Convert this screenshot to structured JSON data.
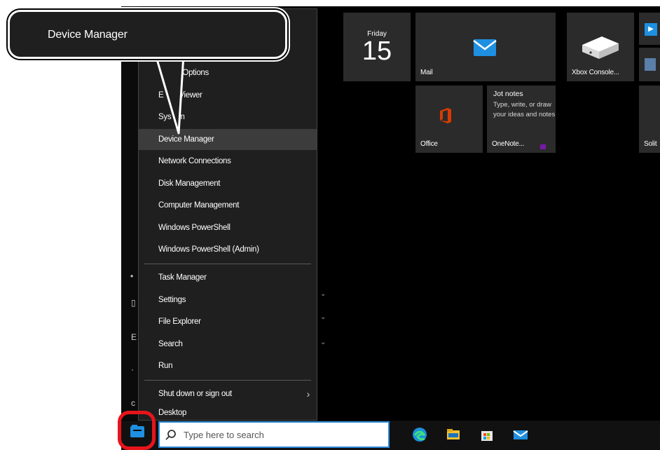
{
  "callout": {
    "text": "Device Manager"
  },
  "winx_menu": {
    "items": [
      {
        "label": "Power Options"
      },
      {
        "label": "Event Viewer"
      },
      {
        "label": "System"
      },
      {
        "label": "Device Manager",
        "selected": true
      },
      {
        "label": "Network Connections"
      },
      {
        "label": "Disk Management"
      },
      {
        "label": "Computer Management"
      },
      {
        "label": "Windows PowerShell"
      },
      {
        "label": "Windows PowerShell (Admin)"
      },
      {
        "label": "Task Manager"
      },
      {
        "label": "Settings"
      },
      {
        "label": "File Explorer"
      },
      {
        "label": "Search"
      },
      {
        "label": "Run"
      },
      {
        "label": "Shut down or sign out",
        "has_submenu": true
      },
      {
        "label": "Desktop"
      }
    ],
    "visible_partial_labels": {
      "power_options": "r Options",
      "event_viewer_prefix": "E",
      "event_viewer_suffix": "Viewer",
      "system_prefix": "Sys",
      "system_suffix": "m"
    }
  },
  "tiles": {
    "calendar": {
      "day": "Friday",
      "date": "15"
    },
    "mail": {
      "label": "Mail",
      "icon": "mail-icon"
    },
    "xbox": {
      "label": "Xbox Console...",
      "icon": "xbox-console-icon"
    },
    "office": {
      "label": "Office",
      "icon": "office-icon"
    },
    "onenote": {
      "title": "Jot notes",
      "body": "Type, write, or draw your ideas and notes",
      "label": "OneNote...",
      "icon": "onenote-icon"
    },
    "solitaire": {
      "label": "Solit"
    }
  },
  "taskbar": {
    "search_placeholder": "Type here to search",
    "icons": [
      "edge-icon",
      "file-explorer-icon",
      "store-icon",
      "mail-icon"
    ]
  },
  "colors": {
    "highlight_red": "#e8141c",
    "search_border": "#2b8ad8",
    "menu_background": "#1f1f1f",
    "selected_item": "#3c3c3c",
    "tile_background": "#2b2b2b",
    "mail_blue": "#1e8fe1",
    "office_red": "#d83b01",
    "onenote_purple": "#7719aa"
  }
}
